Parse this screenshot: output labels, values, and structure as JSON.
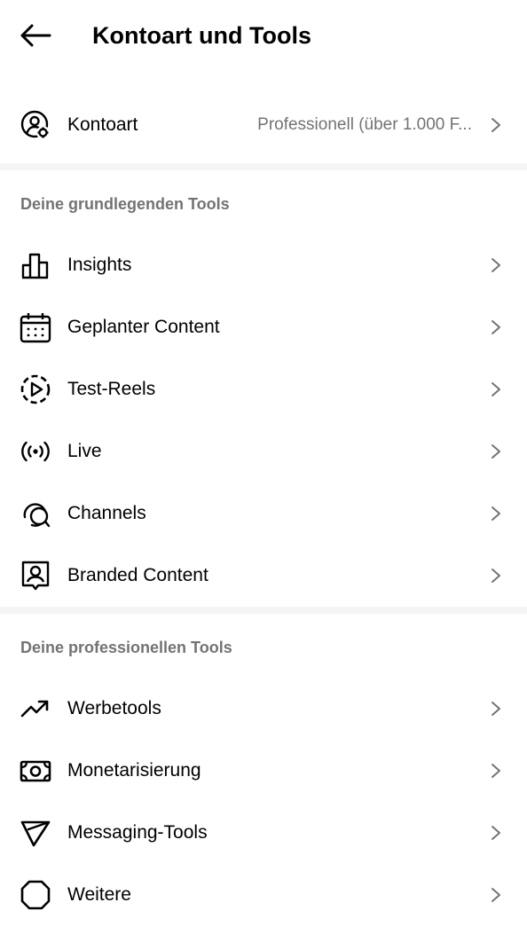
{
  "header": {
    "title": "Kontoart und Tools"
  },
  "account": {
    "label": "Kontoart",
    "value": "Professionell (über 1.000 F..."
  },
  "sections": [
    {
      "title": "Deine grundlegenden Tools",
      "items": [
        {
          "label": "Insights",
          "icon": "bar-chart-icon"
        },
        {
          "label": "Geplanter Content",
          "icon": "calendar-icon"
        },
        {
          "label": "Test-Reels",
          "icon": "reels-play-icon"
        },
        {
          "label": "Live",
          "icon": "live-broadcast-icon"
        },
        {
          "label": "Channels",
          "icon": "channels-chat-icon"
        },
        {
          "label": "Branded Content",
          "icon": "branded-content-icon"
        }
      ]
    },
    {
      "title": "Deine professionellen Tools",
      "items": [
        {
          "label": "Werbetools",
          "icon": "trending-up-icon"
        },
        {
          "label": "Monetarisierung",
          "icon": "money-icon"
        },
        {
          "label": "Messaging-Tools",
          "icon": "messaging-icon"
        },
        {
          "label": "Weitere",
          "icon": "more-octagon-icon"
        }
      ]
    }
  ]
}
